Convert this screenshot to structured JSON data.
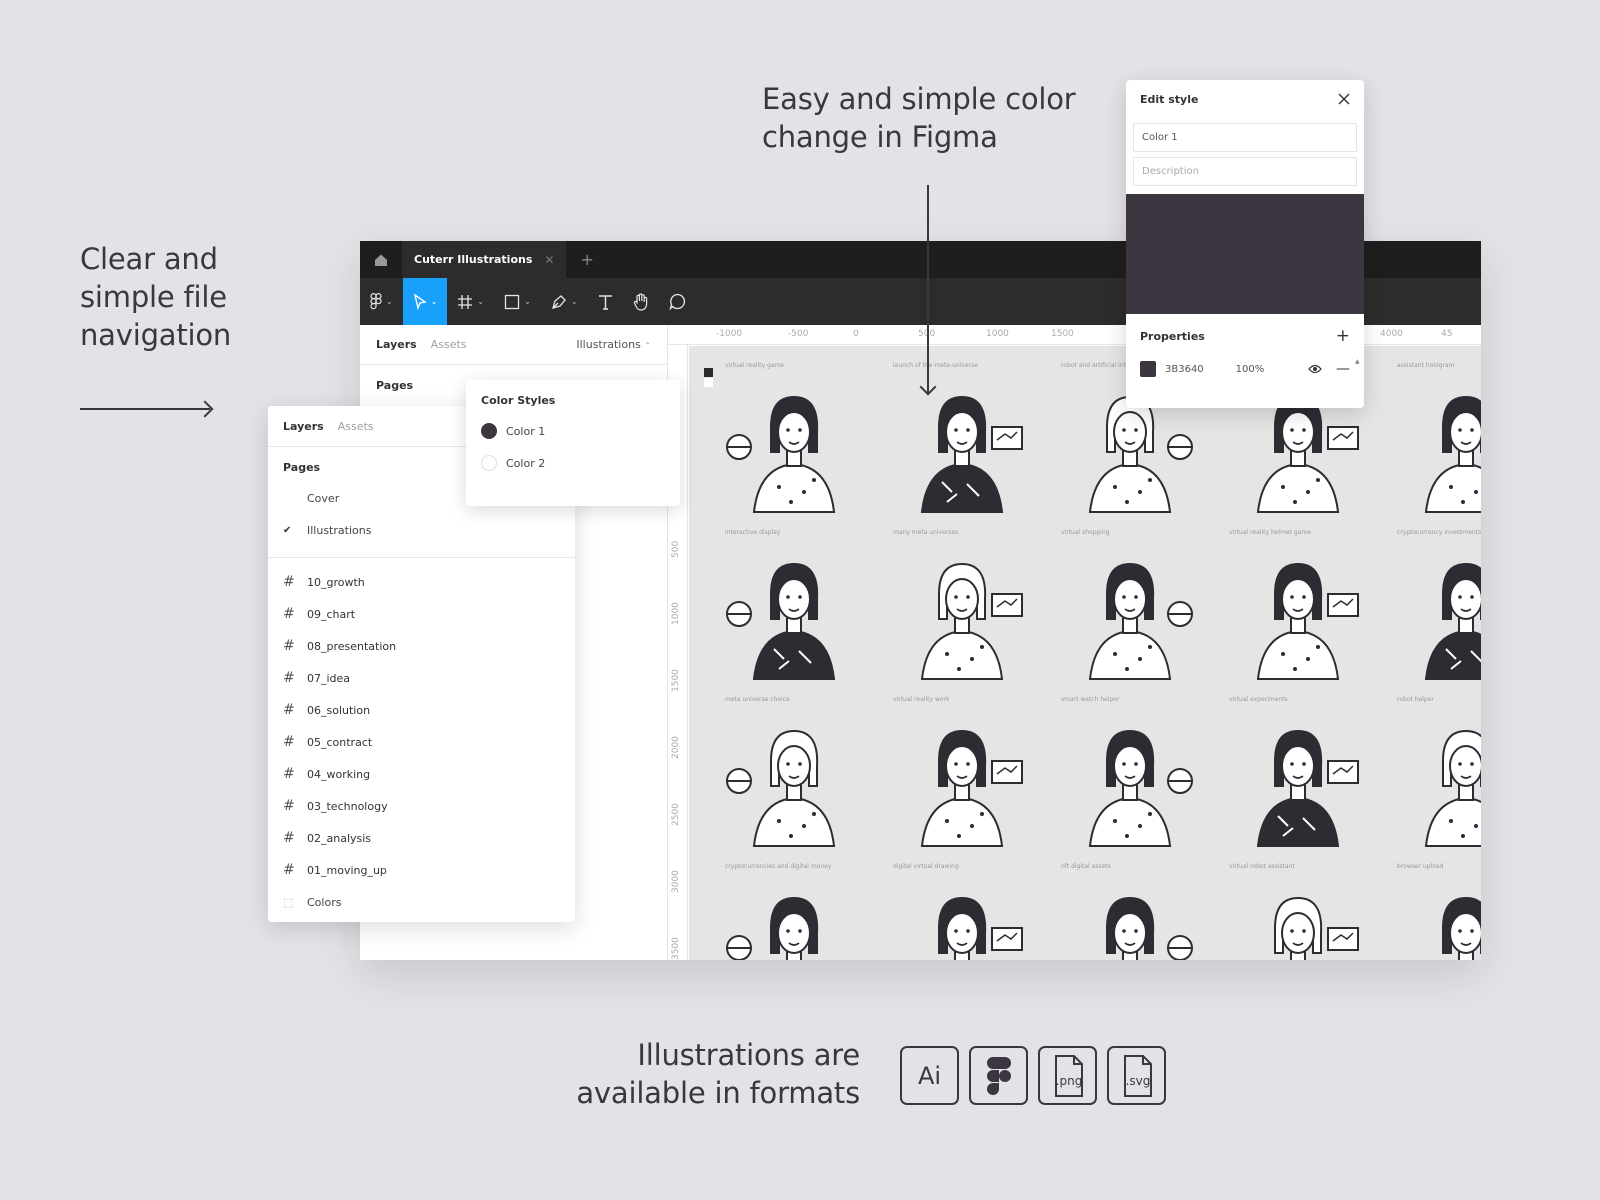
{
  "headlines": {
    "navigation": "Clear and simple file navigation",
    "color": "Easy and simple color change in Figma",
    "formats": "Illustrations are available in formats"
  },
  "window": {
    "tab_title": "Cuterr Illustrations",
    "left_panel": {
      "tab_layers": "Layers",
      "tab_assets": "Assets",
      "page_selector": "Illustrations",
      "pages_heading": "Pages"
    },
    "ruler_top": [
      "-1000",
      "-500",
      "0",
      "500",
      "1000",
      "1500",
      "4000",
      "45"
    ],
    "ruler_left": [
      "500",
      "1000",
      "1500",
      "2000",
      "2500",
      "3000",
      "3500"
    ],
    "illustrations": [
      [
        "virtual reality game",
        "launch of the meta-universe",
        "robot and artificial intelligence",
        "",
        "assistant hologram"
      ],
      [
        "interactive display",
        "many meta universes",
        "virtual shopping",
        "virtual reality helmet game",
        "cryptocurrency investments"
      ],
      [
        "meta universe choice",
        "virtual reality work",
        "smart watch helper",
        "virtual experiments",
        "robot helper"
      ],
      [
        "cryptocurrencies and digital money",
        "digital virtual drawing",
        "nft digital assets",
        "virtual robot assistant",
        "browser upload"
      ]
    ]
  },
  "color_styles": {
    "title": "Color Styles",
    "items": [
      {
        "label": "Color 1",
        "color": "#3b3640"
      },
      {
        "label": "Color 2",
        "color": "#ffffff"
      }
    ]
  },
  "layers_panel": {
    "tab_layers": "Layers",
    "tab_assets": "Assets",
    "pages_heading": "Pages",
    "pages": [
      {
        "label": "Cover",
        "checked": false
      },
      {
        "label": "Illustrations",
        "checked": true
      }
    ],
    "frames": [
      "10_growth",
      "09_chart",
      "08_presentation",
      "07_idea",
      "06_solution",
      "05_contract",
      "04_working",
      "03_technology",
      "02_analysis",
      "01_moving_up"
    ],
    "colors_label": "Colors"
  },
  "edit_style": {
    "title": "Edit style",
    "name_value": "Color 1",
    "description_placeholder": "Description",
    "properties_heading": "Properties",
    "hex": "3B3640",
    "opacity": "100%",
    "swatch_color": "#3b3640"
  },
  "formats": [
    "Ai",
    "figma",
    ".png",
    ".svg"
  ]
}
